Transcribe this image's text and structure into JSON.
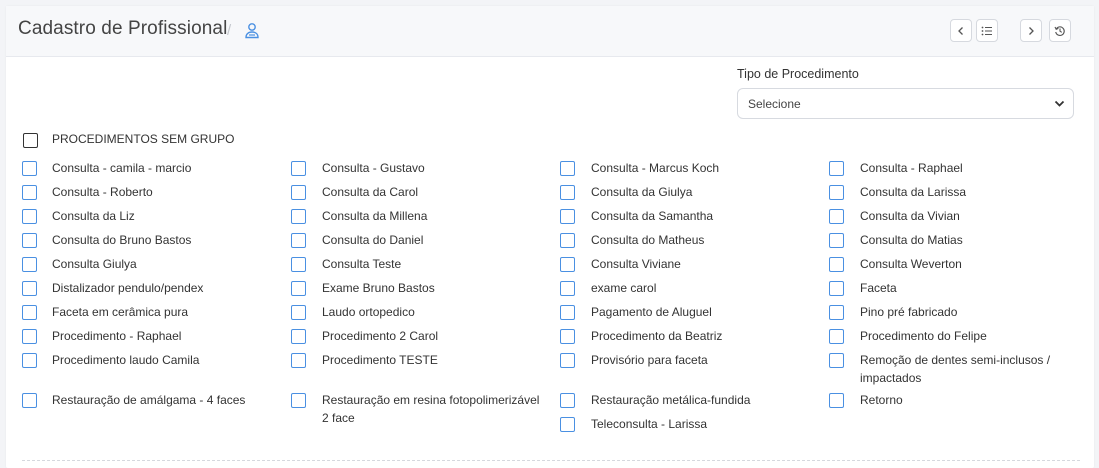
{
  "header": {
    "title": "Cadastro de Profissional",
    "separator": "/",
    "nav": {
      "prev": "‹",
      "list": "list-icon",
      "next": "›",
      "history": "history-icon"
    }
  },
  "filter": {
    "label": "Tipo de Procedimento",
    "select_value": "Selecione"
  },
  "group": {
    "label": "PROCEDIMENTOS SEM GRUPO"
  },
  "procedures": [
    [
      "Consulta - camila - marcio",
      "Consulta - Gustavo",
      "Consulta - Marcus Koch",
      "Consulta - Raphael"
    ],
    [
      "Consulta - Roberto",
      "Consulta da Carol",
      "Consulta da Giulya",
      "Consulta da Larissa"
    ],
    [
      "Consulta da Liz",
      "Consulta da Millena",
      "Consulta da Samantha",
      "Consulta da Vivian"
    ],
    [
      "Consulta do Bruno Bastos",
      "Consulta do Daniel",
      "Consulta do Matheus",
      "Consulta do Matias"
    ],
    [
      "Consulta Giulya",
      "Consulta Teste",
      "Consulta Viviane",
      "Consulta Weverton"
    ],
    [
      "Distalizador pendulo/pendex",
      "Exame Bruno Bastos",
      "exame carol",
      "Faceta"
    ],
    [
      "Faceta em cerâmica pura",
      "Laudo ortopedico",
      "Pagamento de Aluguel",
      "Pino pré fabricado"
    ],
    [
      "Procedimento - Raphael",
      "Procedimento 2 Carol",
      "Procedimento da Beatriz",
      "Procedimento do Felipe"
    ],
    [
      "Procedimento laudo Camila",
      "Procedimento TESTE",
      "Provisório para faceta",
      "Remoção de dentes semi-inclusos / impactados"
    ],
    [
      "Restauração de amálgama - 4 faces",
      "Restauração em resina fotopolimerizável 2 face",
      "Restauração metálica-fundida",
      "Retorno"
    ],
    [
      "",
      "",
      "Teleconsulta - Larissa",
      ""
    ]
  ]
}
